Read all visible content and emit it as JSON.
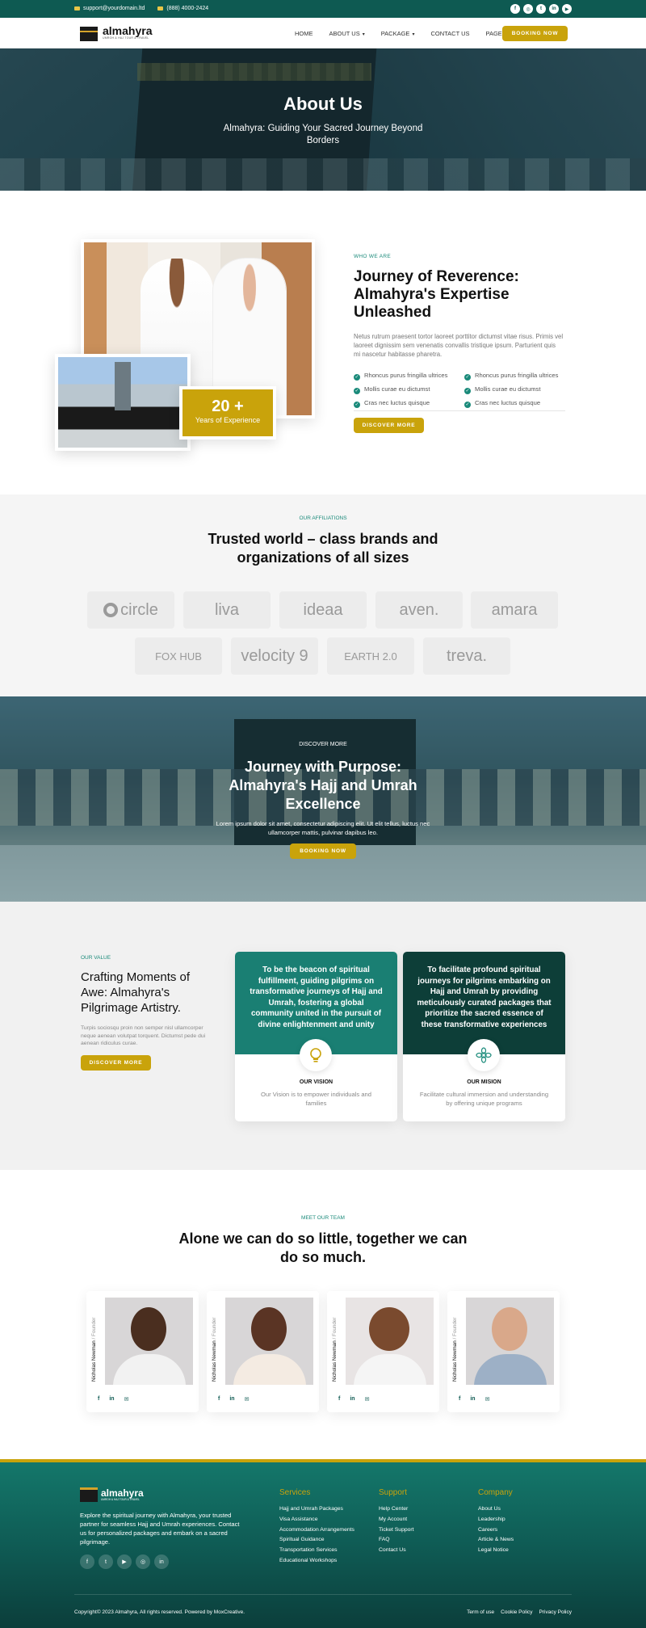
{
  "topbar": {
    "email": "support@yourdomain.ltd",
    "phone": "(888) 4000-2424",
    "socials": [
      "f",
      "◎",
      "t",
      "in",
      "▶"
    ]
  },
  "brand": {
    "name": "almahyra",
    "tagline": "UMROH & HAJ TOUR & TRAVEL"
  },
  "nav": {
    "items": [
      "HOME",
      "ABOUT US",
      "PACKAGE",
      "CONTACT US",
      "PAGES"
    ],
    "cta": "BOOKING NOW"
  },
  "hero": {
    "title": "About Us",
    "subtitle": "Almahyra: Guiding Your Sacred Journey Beyond Borders"
  },
  "who": {
    "eyebrow": "WHO WE ARE",
    "title": "Journey of Reverence: Almahyra's Expertise Unleashed",
    "description": "Netus rutrum praesent tortor laoreet porttitor dictumst vitae risus. Primis vel laoreet dignissim sem venenatis convallis tristique ipsum. Parturient quis mi nascetur habitasse pharetra.",
    "badge_number": "20 +",
    "badge_label": "Years of Experience",
    "checks": [
      "Rhoncus purus fringilla ultrices",
      "Rhoncus purus fringilla ultrices",
      "Mollis curae eu dictumst",
      "Mollis curae eu dictumst",
      "Cras nec luctus quisque",
      "Cras nec luctus quisque"
    ],
    "button": "DISCOVER MORE"
  },
  "affiliations": {
    "eyebrow": "OUR AFFILIATIONS",
    "title": "Trusted world – class brands and organizations of all sizes",
    "logos": [
      "circle",
      "liva",
      "ideaa",
      "aven.",
      "amara",
      "FOX HUB",
      "velocity 9",
      "EARTH 2.0",
      "treva."
    ]
  },
  "journey": {
    "eyebrow": "DISCOVER MORE",
    "title": "Journey with Purpose: Almahyra's Hajj and Umrah Excellence",
    "text": "Lorem ipsum dolor sit amet, consectetur adipiscing elit. Ut elit tellus, luctus nec ullamcorper mattis, pulvinar dapibus leo.",
    "button": "BOOKING NOW"
  },
  "values": {
    "eyebrow": "OUR VALUE",
    "title": "Crafting Moments of Awe: Almahyra's Pilgrimage Artistry.",
    "description": "Turpis sociosqu proin non semper nisl ullamcorper neque aenean volutpat torquent. Dictumst pede dui aenean ridiculus curae.",
    "button": "DISCOVER MORE",
    "cards": [
      {
        "statement": "To be the beacon of spiritual fulfillment, guiding pilgrims on transformative journeys of Hajj and Umrah, fostering a global community united in the pursuit of divine enlightenment and unity",
        "title": "OUR VISION",
        "text": "Our Vision is to empower individuals and families",
        "color": "#1a7f73"
      },
      {
        "statement": "To facilitate profound spiritual journeys for pilgrims embarking on Hajj and Umrah by providing meticulously curated packages that prioritize the sacred essence of these transformative experiences",
        "title": "OUR MISION",
        "text": "Facilitate cultural immersion and understanding by offering unique programs",
        "color": "#0d3e38"
      }
    ]
  },
  "team": {
    "eyebrow": "MEET OUR TEAM",
    "title": "Alone we can do so little, together we can do so much.",
    "members": [
      {
        "name": "Nicholas Newman",
        "role": "Founder"
      },
      {
        "name": "Nicholas Newman",
        "role": "Founder"
      },
      {
        "name": "Nicholas Newman",
        "role": "Founder"
      },
      {
        "name": "Nicholas Newman",
        "role": "Founder"
      }
    ]
  },
  "footer": {
    "about": "Explore the spiritual journey with Almahyra, your trusted partner for seamless Hajj and Umrah experiences. Contact us for personalized packages and embark on a sacred pilgrimage.",
    "services_title": "Services",
    "services": [
      "Hajj and Umrah Packages",
      "Visa Assistance",
      "Accommodation Arrangements",
      "Spiritual Guidance",
      "Transportation Services",
      "Educational Workshops"
    ],
    "support_title": "Support",
    "support": [
      "Help Center",
      "My Account",
      "Ticket Support",
      "FAQ",
      "Contact Us"
    ],
    "company_title": "Company",
    "company": [
      "About Us",
      "Leadership",
      "Careers",
      "Article & News",
      "Legal Notice"
    ],
    "copyright": "Copyright© 2023 Almahyra, All rights reserved. Powered by MoxCreative.",
    "legal": [
      "Term of use",
      "Cookie Policy",
      "Privacy Policy"
    ]
  }
}
